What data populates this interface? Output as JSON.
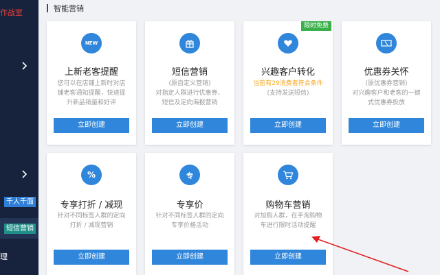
{
  "sidebar": {
    "brand_text": "作战室",
    "tag_blue": "千人千面",
    "tag_active": "短信营销",
    "bottom_text": "理"
  },
  "section": {
    "title": "智能营销"
  },
  "cards": [
    {
      "title": "上新老客提醒",
      "icon": "new-icon",
      "icon_text": "NEW",
      "desc": [
        "您可以在店铺上新时对店",
        "铺老客通知提醒，快速提",
        "升新品销量和好评"
      ],
      "button": "立即创建"
    },
    {
      "title": "短信营销",
      "icon": "gift-icon",
      "desc": [
        "(原自定义营销)",
        "对指定人群进行优惠券、",
        "短信及定向海报营销"
      ],
      "button": "立即创建"
    },
    {
      "title": "兴趣客户转化",
      "icon": "heart-icon",
      "badge": "限时免费",
      "warn": "当前有29消费者符合条件",
      "desc": [
        "(支持发送短信)"
      ],
      "button": "立即创建"
    },
    {
      "title": "优惠券关怀",
      "icon": "coupon-icon",
      "desc": [
        "(原优惠券营销)",
        "对兴趣客户和老客的一键",
        "式优惠券投放"
      ],
      "button": "立即创建"
    },
    {
      "title": "专享打折 / 减现",
      "icon": "percent-icon",
      "icon_text": "%",
      "desc": [
        "针对不同标签人群的定向",
        "打折 / 减现营销"
      ],
      "button": "立即创建"
    },
    {
      "title": "专享价",
      "icon": "exclusive-icon",
      "icon_text": "专",
      "desc": [
        "针对不同标签人群的定向",
        "专享价格活动"
      ],
      "button": "立即创建"
    },
    {
      "title": "购物车营销",
      "icon": "cart-icon",
      "desc": [
        "对加购人群，在手淘购物",
        "车进行限时活动提醒"
      ],
      "button": "立即创建"
    }
  ],
  "colors": {
    "sidebar": "#17233d",
    "accent": "#2f86db",
    "badge": "#3ab04a",
    "warn": "#f5a623",
    "arrow": "#e02020"
  }
}
